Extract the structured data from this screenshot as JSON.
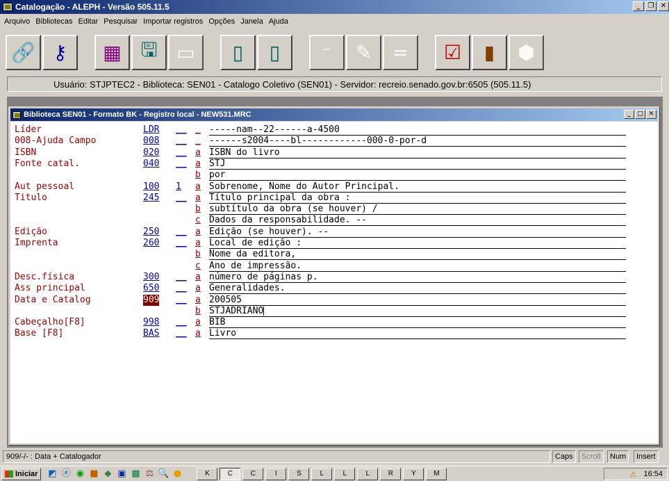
{
  "window": {
    "title": "Catalogação - ALEPH - Versão 505.11.5"
  },
  "menu": [
    "Arquivo",
    "Bibliotecas",
    "Editar",
    "Pesquisar",
    "Importar registros",
    "Opções",
    "Janela",
    "Ajuda"
  ],
  "toolbar": {
    "buttons": [
      {
        "icon": "link-icon",
        "glyph": "🔗"
      },
      {
        "icon": "key-icon",
        "glyph": "⚷"
      },
      {
        "icon": "form-icon",
        "glyph": "▦"
      },
      {
        "icon": "save-icon",
        "glyph": "🖫"
      },
      {
        "icon": "minus-icon",
        "glyph": "▭"
      },
      {
        "icon": "copy-icon",
        "glyph": "▯"
      },
      {
        "icon": "copy-arrow-icon",
        "glyph": "▯"
      },
      {
        "icon": "line-icon",
        "glyph": "⁻"
      },
      {
        "icon": "pencil-icon",
        "glyph": "✎"
      },
      {
        "icon": "equals-icon",
        "glyph": "="
      },
      {
        "icon": "check-icon",
        "glyph": "☑"
      },
      {
        "icon": "door-icon",
        "glyph": "▮"
      },
      {
        "icon": "stop-icon",
        "glyph": "⬢"
      }
    ]
  },
  "userline": "Usuário: STJPTEC2 - Biblioteca: SEN01 - Catalogo Coletivo (SEN01) - Servidor: recreio.senado.gov.br:6505 (505.11.5)",
  "child": {
    "title": "Biblioteca SEN01 - Formato BK - Registro local - NEW531.MRC"
  },
  "record": [
    {
      "label": "Líder",
      "tag": "LDR",
      "ind": "__",
      "sub": "_",
      "value": "-----nam--22------a-4500"
    },
    {
      "label": "008-Ajuda Campo",
      "tag": "008",
      "ind": "__",
      "sub": "_",
      "value": "------s2004----bl------------000-0-por-d"
    },
    {
      "label": "ISBN",
      "tag": "020",
      "ind": "__",
      "sub": "a",
      "value": "ISBN do livro"
    },
    {
      "label": "Fonte catal.",
      "tag": "040",
      "ind": "__",
      "sub": "a",
      "value": "STJ"
    },
    {
      "label": "",
      "tag": "",
      "ind": "",
      "sub": "b",
      "value": "por"
    },
    {
      "label": "Aut pessoal",
      "tag": "100",
      "ind": "1",
      "sub": "a",
      "value": "Sobrenome, Nome do Autor Principal."
    },
    {
      "label": "Titulo",
      "tag": "245",
      "ind": "__",
      "sub": "a",
      "value": "Título principal da obra :"
    },
    {
      "label": "",
      "tag": "",
      "ind": "",
      "sub": "b",
      "value": "subtítulo da obra (se houver) /"
    },
    {
      "label": "",
      "tag": "",
      "ind": "",
      "sub": "c",
      "value": "Dados da responsabilidade. --"
    },
    {
      "label": "Edição",
      "tag": "250",
      "ind": "__",
      "sub": "a",
      "value": "Edição (se houver). --"
    },
    {
      "label": "Imprenta",
      "tag": "260",
      "ind": "__",
      "sub": "a",
      "value": "Local de edição :"
    },
    {
      "label": "",
      "tag": "",
      "ind": "",
      "sub": "b",
      "value": "Nome da editora,"
    },
    {
      "label": "",
      "tag": "",
      "ind": "",
      "sub": "c",
      "value": "Ano de impressão."
    },
    {
      "label": "Desc.física",
      "tag": "300",
      "ind": "__",
      "sub": "a",
      "value": "número de páginas p."
    },
    {
      "label": "Ass principal",
      "tag": "650",
      "ind": "__",
      "sub": "a",
      "value": "Generalidades."
    },
    {
      "label": "Data e Catalog",
      "tag": "909",
      "ind": "__",
      "sub": "a",
      "value": "200505",
      "selected": true
    },
    {
      "label": "",
      "tag": "",
      "ind": "",
      "sub": "b",
      "value": "STJADRIANO",
      "caret": true
    },
    {
      "label": "Cabeçalho[F8]",
      "tag": "998",
      "ind": "__",
      "sub": "a",
      "value": "BIB"
    },
    {
      "label": "Base [F8]",
      "tag": "BAS",
      "ind": "__",
      "sub": "a",
      "value": "Livro"
    }
  ],
  "status": {
    "message": "909/-/- : Data + Catalogador",
    "caps": "Caps",
    "scroll": "Scroll",
    "num": "Num",
    "insert": "Insert"
  },
  "taskbar": {
    "start": "Iniciar",
    "tasks": [
      "K",
      "C",
      "C",
      "I",
      "S",
      "L",
      "L",
      "L",
      "R",
      "Y",
      "M"
    ],
    "clock": "16:54"
  }
}
